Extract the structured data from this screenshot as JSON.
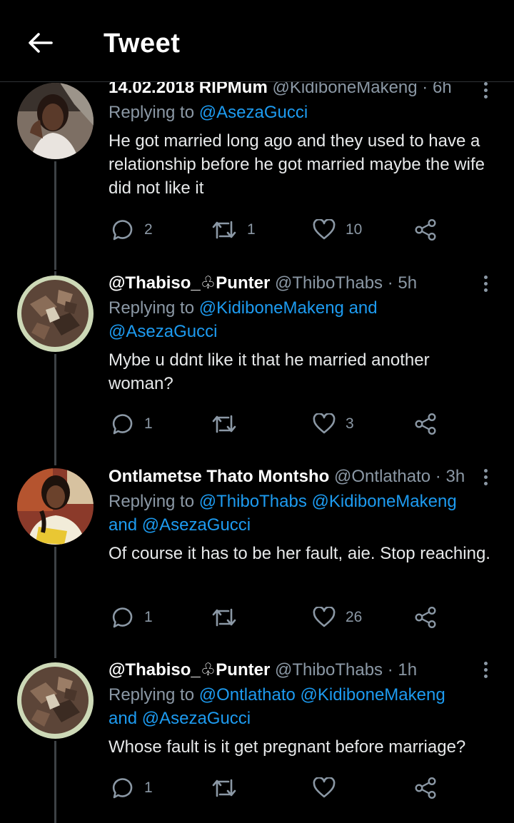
{
  "header": {
    "title": "Tweet",
    "back_icon": "arrow-left-icon"
  },
  "colors": {
    "background": "#000000",
    "link": "#1d9bf0",
    "muted": "#8b98a5",
    "text": "#e7e9ea",
    "divider": "#2f3336"
  },
  "tweets": [
    {
      "display_name": "14.02.2018 RIPMum",
      "handle": "@KidiboneMakeng",
      "sep": "·",
      "time": "6h",
      "replying_prefix": "Replying to",
      "mentions_line1": "@AsezaGucci",
      "and_word": "",
      "mentions_line2": "",
      "text": "He got married long ago and they used to have a relationship before he got married maybe the wife did not like it",
      "replies": "2",
      "retweets": "1",
      "likes": "10"
    },
    {
      "display_name": "@Thabiso_♧Punter",
      "handle": "@ThiboThabs",
      "sep": "·",
      "time": "5h",
      "replying_prefix": "Replying to",
      "mentions_line1": "@KidiboneMakeng",
      "and_word": "and",
      "mentions_line2": "@AsezaGucci",
      "text": "Mybe u ddnt like it that he married another woman?",
      "replies": "1",
      "retweets": "",
      "likes": "3"
    },
    {
      "display_name": "Ontlametse Thato Montsho",
      "handle": "@Ontlathato",
      "sep": "·",
      "time": "3h",
      "replying_prefix": "Replying to",
      "mentions_line1": "@ThiboThabs @KidiboneMakeng",
      "and_word": "and",
      "mentions_line2": "@AsezaGucci",
      "text": "Of course it has to be her fault, aie. Stop reaching.",
      "replies": "1",
      "retweets": "",
      "likes": "26"
    },
    {
      "display_name": "@Thabiso_♧Punter",
      "handle": "@ThiboThabs",
      "sep": "·",
      "time": "1h",
      "replying_prefix": "Replying to",
      "mentions_line1": "@Ontlathato @KidiboneMakeng",
      "and_word": "and",
      "mentions_line2": "@AsezaGucci",
      "text": "Whose fault is it get pregnant before marriage?",
      "replies": "1",
      "retweets": "",
      "likes": ""
    }
  ]
}
